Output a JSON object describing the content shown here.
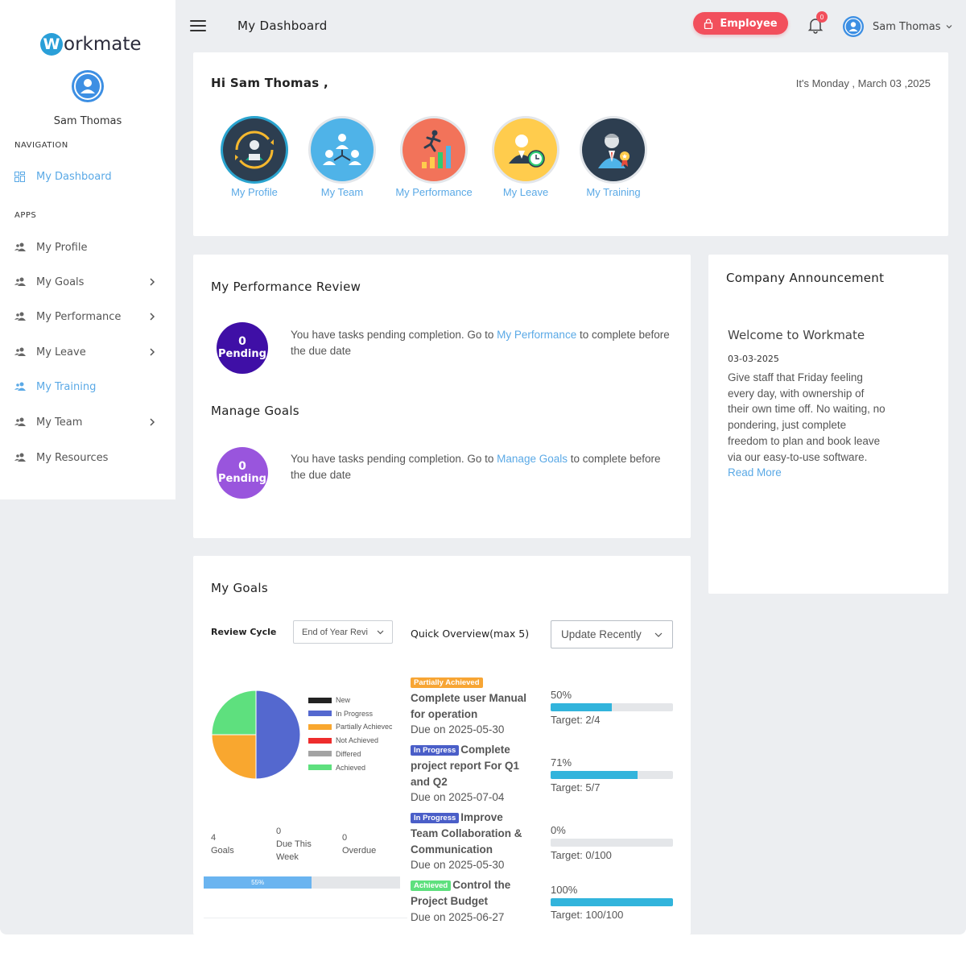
{
  "brand": {
    "logo_letter": "W",
    "logo_text": "orkmate"
  },
  "sidebar": {
    "user_name": "Sam Thomas",
    "navigation_label": "NAVIGATION",
    "dashboard_label": "My Dashboard",
    "apps_label": "APPS",
    "items": [
      {
        "label": "My Profile",
        "has_submenu": false
      },
      {
        "label": "My Goals",
        "has_submenu": true
      },
      {
        "label": "My Performance",
        "has_submenu": true
      },
      {
        "label": "My Leave",
        "has_submenu": true
      },
      {
        "label": "My Training",
        "has_submenu": false,
        "active": true
      },
      {
        "label": "My Team",
        "has_submenu": true
      },
      {
        "label": "My Resources",
        "has_submenu": false
      }
    ]
  },
  "header": {
    "title": "My Dashboard",
    "role_label": "Employee",
    "notification_count": "0",
    "user_name": "Sam Thomas"
  },
  "greeting": {
    "text": "Hi Sam Thomas ,",
    "date": "It's Monday , March 03 ,2025",
    "tiles": [
      {
        "label": "My Profile",
        "icon": "profile-icon",
        "color": "#2d3e50"
      },
      {
        "label": "My Team",
        "icon": "team-icon",
        "color": "#4fb3e8"
      },
      {
        "label": "My Performance",
        "icon": "performance-icon",
        "color": "#f2735a"
      },
      {
        "label": "My Leave",
        "icon": "leave-icon",
        "color": "#ffcc4d"
      },
      {
        "label": "My Training",
        "icon": "training-icon",
        "color": "#2d3e50"
      }
    ]
  },
  "performance_review": {
    "title": "My Performance Review",
    "count": "0",
    "status": "Pending",
    "msg_before": "You have tasks pending completion. Go to ",
    "link": "My Performance",
    "msg_after": " to complete before the due date"
  },
  "manage_goals": {
    "title": "Manage Goals",
    "count": "0",
    "status": "Pending",
    "msg_before": "You have tasks pending completion. Go to ",
    "link": "Manage Goals",
    "msg_after": " to complete before the due date"
  },
  "announcement": {
    "card_title": "Company Announcement",
    "title": "Welcome to Workmate",
    "date": "03-03-2025",
    "body": "Give staff that Friday feeling every day, with ownership of their own time off. No waiting, no pondering, just complete freedom to plan and book leave via our easy-to-use software. ",
    "read_more": "Read More"
  },
  "goals": {
    "title": "My Goals",
    "review_cycle_label": "Review Cycle",
    "review_cycle_value": "End of Year Revi",
    "quick_overview_label": "Quick Overview(max 5)",
    "sort_value": "Update Recently",
    "stats": [
      {
        "value": "4",
        "label": "Goals"
      },
      {
        "value": "0",
        "label": "Due This Week"
      },
      {
        "value": "0",
        "label": "Overdue"
      }
    ],
    "overall_progress_label": "55%",
    "overall_progress": 0.55,
    "items": [
      {
        "status": "Partially Achieved",
        "status_color": "#f7a534",
        "title": "Complete user Manual for operation",
        "due": "Due on 2025-05-30",
        "percent_label": "50%",
        "percent": 50,
        "target": "Target: 2/4"
      },
      {
        "status": "In Progress",
        "status_color": "#4a5ec8",
        "title": "Complete project report For Q1 and Q2",
        "due": "Due on 2025-07-04",
        "percent_label": "71%",
        "percent": 71,
        "target": "Target: 5/7"
      },
      {
        "status": "In Progress",
        "status_color": "#4a5ec8",
        "title": "Improve Team Collaboration & Communication",
        "due": "Due on 2025-05-30",
        "percent_label": "0%",
        "percent": 0,
        "target": "Target: 0/100"
      },
      {
        "status": "Achieved",
        "status_color": "#5ee07e",
        "title": "Control the Project Budget",
        "due": "Due on 2025-06-27",
        "percent_label": "100%",
        "percent": 100,
        "target": "Target: 100/100"
      }
    ]
  },
  "chart_data": {
    "type": "pie",
    "title": "",
    "legend_position": "right",
    "categories": [
      "New",
      "In Progress",
      "Partially Achieved",
      "Not Achieved",
      "Differed",
      "Achieved"
    ],
    "legend_labels": [
      "New",
      "In Progress",
      "Partially Achievec",
      "Not Achieved",
      "Differed",
      "Achieved"
    ],
    "values": [
      0,
      2,
      1,
      0,
      0,
      1
    ],
    "colors": [
      "#222222",
      "#5468cf",
      "#f9a72f",
      "#ee2d2d",
      "#a3a3a3",
      "#5ee07e"
    ]
  }
}
